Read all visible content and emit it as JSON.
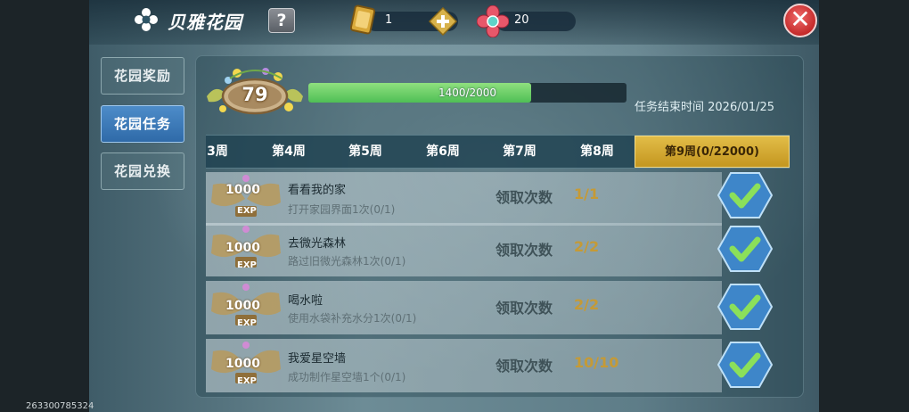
{
  "header": {
    "title": "贝雅花园",
    "help_label": "?",
    "coins": "1",
    "gems": "20",
    "close_label": "✕",
    "icons": [
      "flower-icon",
      "coin-icon",
      "plus-icon",
      "gem-icon",
      "close-icon"
    ]
  },
  "sidebar": {
    "items": [
      {
        "label": "花园奖励",
        "active": false
      },
      {
        "label": "花园任务",
        "active": true
      },
      {
        "label": "花园兑换",
        "active": false
      }
    ]
  },
  "garden": {
    "level": "79",
    "progress_text": "1400/2000",
    "progress_fraction": 0.7,
    "end_time": "任务结束时间 2026/01/25"
  },
  "weeks": {
    "tabs": [
      "3周",
      "第4周",
      "第5周",
      "第6周",
      "第7周",
      "第8周",
      "第9周(0/22000)"
    ],
    "active_index": 6
  },
  "tasks": [
    {
      "reward": "1000",
      "reward_unit": "EXP",
      "title": "看看我的家",
      "desc": "打开家园界面1次(0/1)",
      "claim_label": "领取次数",
      "claim_value": "1/1"
    },
    {
      "reward": "1000",
      "reward_unit": "EXP",
      "title": "去微光森林",
      "desc": "路过旧微光森林1次(0/1)",
      "claim_label": "领取次数",
      "claim_value": "2/2"
    },
    {
      "reward": "1000",
      "reward_unit": "EXP",
      "title": "喝水啦",
      "desc": "使用水袋补充水分1次(0/1)",
      "claim_label": "领取次数",
      "claim_value": "2/2"
    },
    {
      "reward": "1000",
      "reward_unit": "EXP",
      "title": "我爱星空墙",
      "desc": "成功制作星空墙1个(0/1)",
      "claim_label": "领取次数",
      "claim_value": "10/10"
    }
  ],
  "footer": {
    "id": "263300785324"
  },
  "colors": {
    "accent_gold": "#c4961f",
    "progress_green": "#4fbf55",
    "active_blue": "#2f6aa8",
    "close_red": "#c42a2a"
  }
}
